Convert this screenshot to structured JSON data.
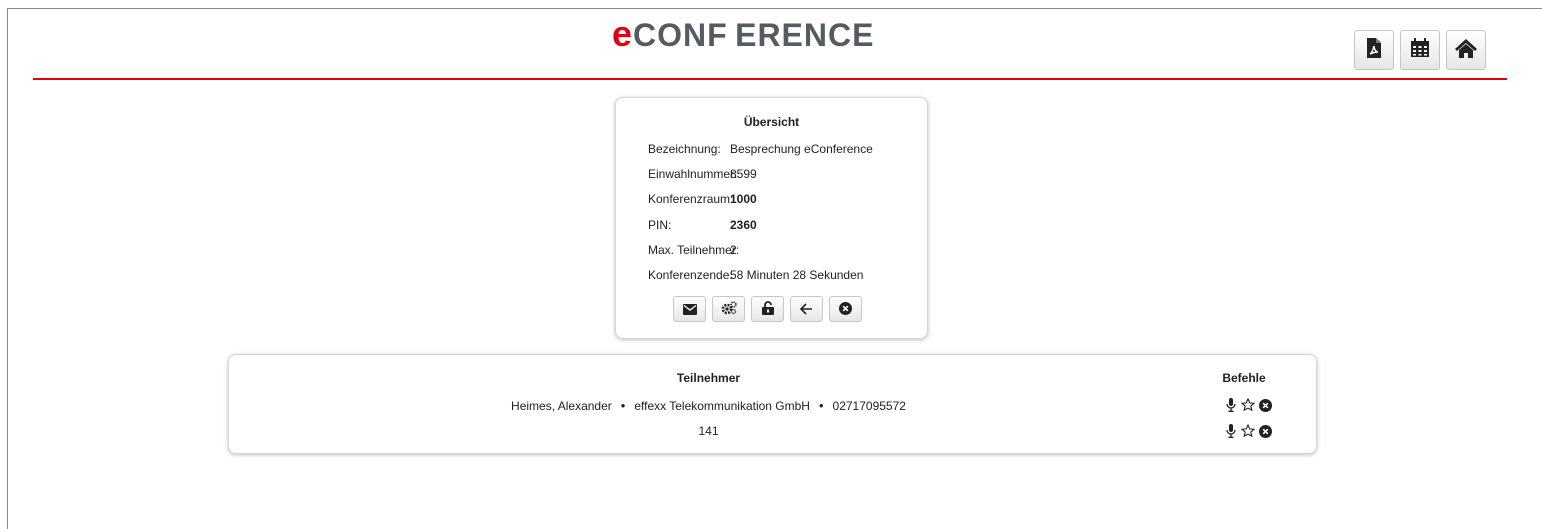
{
  "header": {
    "logo_first": "e",
    "logo_rest": "CONF ERENCE",
    "accent_color": "#e3000f",
    "buttons": [
      {
        "icon": "pdf-icon"
      },
      {
        "icon": "calendar-icon"
      },
      {
        "icon": "home-icon"
      }
    ]
  },
  "overview": {
    "title": "Übersicht",
    "rows": [
      {
        "label": "Bezeichnung:",
        "value": "Besprechung eConference",
        "bold": false
      },
      {
        "label": "Einwahlnummer:",
        "value": "8599",
        "bold": false
      },
      {
        "label": "Konferenzraum:",
        "value": "1000",
        "bold": true
      },
      {
        "label": "PIN:",
        "value": "2360",
        "bold": true
      },
      {
        "label": "Max. Teilnehmer:",
        "value": "2",
        "bold": false
      },
      {
        "label": "Konferenzende:",
        "value": "58 Minuten 28 Sekunden",
        "bold": false
      }
    ],
    "actions": [
      "envelope-icon",
      "gears-icon",
      "unlock-icon",
      "arrow-left-icon",
      "close-circle-icon"
    ]
  },
  "participants": {
    "title": "Teilnehmer",
    "commands_title": "Befehle",
    "separator": "•",
    "rows": [
      {
        "name": "Heimes, Alexander",
        "company": "effexx Telekommunikation GmbH",
        "number": "02717095572"
      },
      {
        "name": "141",
        "company": "",
        "number": ""
      }
    ],
    "row_commands": [
      "microphone-icon",
      "star-outline-icon",
      "close-circle-icon"
    ]
  }
}
